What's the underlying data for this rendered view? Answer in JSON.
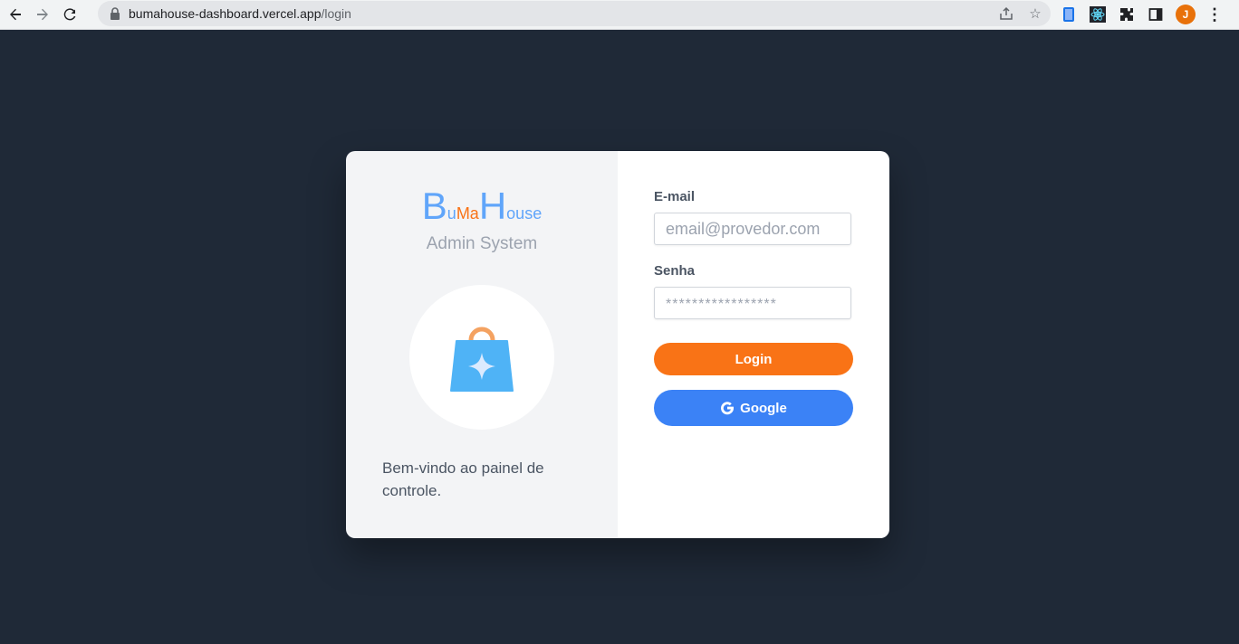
{
  "browser": {
    "url_host": "bumahouse-dashboard.vercel.app",
    "url_path": "/login",
    "profile_initial": "J"
  },
  "brand": {
    "letter_b": "B",
    "uma_u": "u",
    "uma_ma": "Ma",
    "letter_h": "H",
    "ouse": "ouse",
    "subtitle": "Admin System"
  },
  "welcome": "Bem-vindo ao painel de controle.",
  "form": {
    "email_label": "E-mail",
    "email_placeholder": "email@provedor.com",
    "password_label": "Senha",
    "password_placeholder": "*****************",
    "login_label": "Login",
    "google_label": "Google"
  },
  "colors": {
    "background": "#1f2937",
    "accent_orange": "#f97316",
    "accent_blue": "#3b82f6",
    "brand_blue": "#60a5fa"
  },
  "icons": [
    "back-arrow-icon",
    "forward-arrow-icon",
    "reload-icon",
    "lock-icon",
    "share-icon",
    "star-icon",
    "extension-icon",
    "puzzle-icon",
    "side-panel-icon",
    "more-vert-icon",
    "shopping-bag-icon",
    "google-g-icon"
  ]
}
